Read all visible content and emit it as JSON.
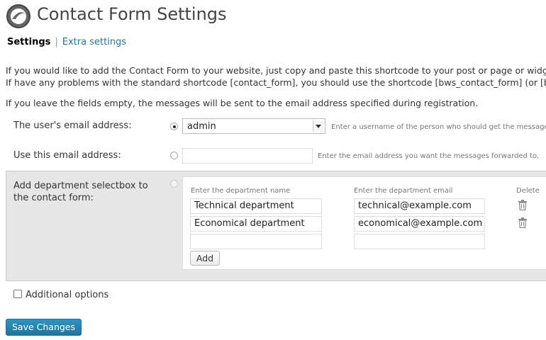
{
  "page": {
    "title": "Contact Form Settings"
  },
  "tabs": {
    "active": "Settings",
    "separator": "|",
    "extra": "Extra settings"
  },
  "intro": {
    "line1": "If you would like to add the Contact Form to your website, just copy and paste this shortcode to your post or page or widget: [",
    "line2": "If have any problems with the standard shortcode [contact_form], you should use the shortcode [bws_contact_form] (or [bws",
    "line3": "If you leave the fields empty, the messages will be sent to the email address specified during registration."
  },
  "user_email": {
    "label": "The user's email address:",
    "selected": "admin",
    "hint": "Enter a username of the person who should get the messages"
  },
  "custom_email": {
    "label": "Use this email address:",
    "value": "",
    "hint": "Enter the email address you want the messages forwarded to."
  },
  "departments": {
    "label_line1": "Add department selectbox to",
    "label_line2": "the contact form:",
    "col_name": "Enter the department name",
    "col_email": "Enter the department email",
    "col_delete": "Delete",
    "rows": [
      {
        "name": "Technical department",
        "email": "technical@example.com"
      },
      {
        "name": "Economical department",
        "email": "economical@example.com"
      },
      {
        "name": "",
        "email": ""
      }
    ],
    "add_label": "Add"
  },
  "additional": {
    "label": "Additional options"
  },
  "save": {
    "label": "Save Changes"
  },
  "colors": {
    "link": "#21759b",
    "primary_button": "#21759b",
    "panel_bg": "#e6e6e6"
  }
}
